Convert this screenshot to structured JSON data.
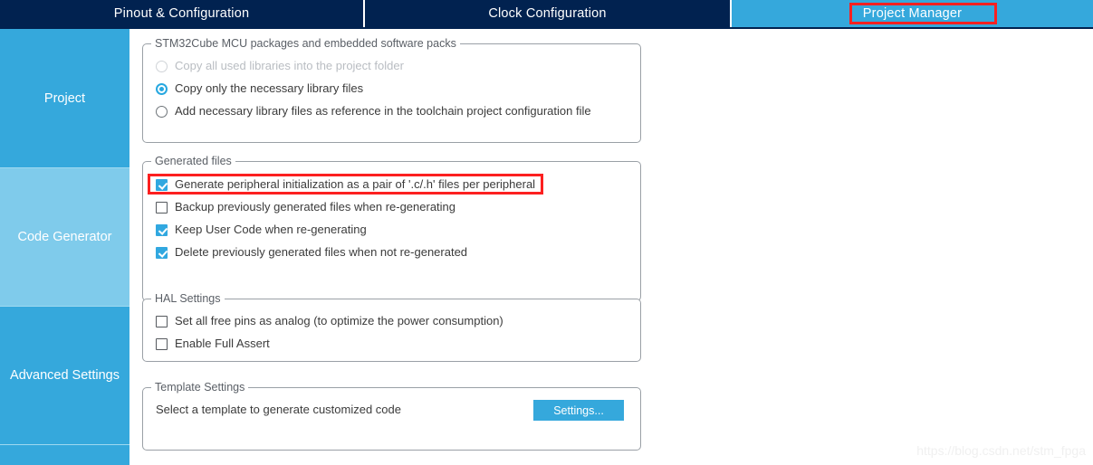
{
  "tabs": [
    {
      "id": "pinout",
      "label": "Pinout & Configuration",
      "active": false
    },
    {
      "id": "clock",
      "label": "Clock Configuration",
      "active": false
    },
    {
      "id": "project",
      "label": "Project Manager",
      "active": true
    }
  ],
  "sidebar": {
    "items": [
      {
        "label": "Project",
        "selected": false
      },
      {
        "label": "Code Generator",
        "selected": true
      },
      {
        "label": "Advanced Settings",
        "selected": false
      },
      {
        "label": "",
        "selected": false
      }
    ]
  },
  "groups": {
    "packs": {
      "title": "STM32Cube MCU packages and embedded software packs",
      "options": [
        {
          "label": "Copy all used libraries into the project folder",
          "checked": false,
          "disabled": true
        },
        {
          "label": "Copy only the necessary library files",
          "checked": true,
          "disabled": false
        },
        {
          "label": "Add necessary library files as reference in the toolchain project configuration file",
          "checked": false,
          "disabled": false
        }
      ]
    },
    "generated": {
      "title": "Generated files",
      "options": [
        {
          "label": "Generate peripheral initialization as a pair of '.c/.h' files per peripheral",
          "checked": true
        },
        {
          "label": "Backup previously generated files when re-generating",
          "checked": false
        },
        {
          "label": "Keep User Code when re-generating",
          "checked": true
        },
        {
          "label": "Delete previously generated files when not re-generated",
          "checked": true
        }
      ]
    },
    "hal": {
      "title": "HAL Settings",
      "options": [
        {
          "label": "Set all free pins as analog (to optimize the power consumption)",
          "checked": false
        },
        {
          "label": "Enable Full Assert",
          "checked": false
        }
      ]
    },
    "template": {
      "title": "Template Settings",
      "description": "Select a template to generate customized code",
      "button_label": "Settings..."
    }
  },
  "annotations": {
    "tab_highlight_color": "#fc2020",
    "checkbox_highlight_color": "#fc2020"
  },
  "colors": {
    "tabbar_bg": "#012250",
    "accent_blue": "#35a8dc",
    "selected_sidebar": "#7fcbeb",
    "control_blue": "#31a8e0"
  },
  "watermark": {
    "text": "https://blog.csdn.net/stm_fpga"
  }
}
